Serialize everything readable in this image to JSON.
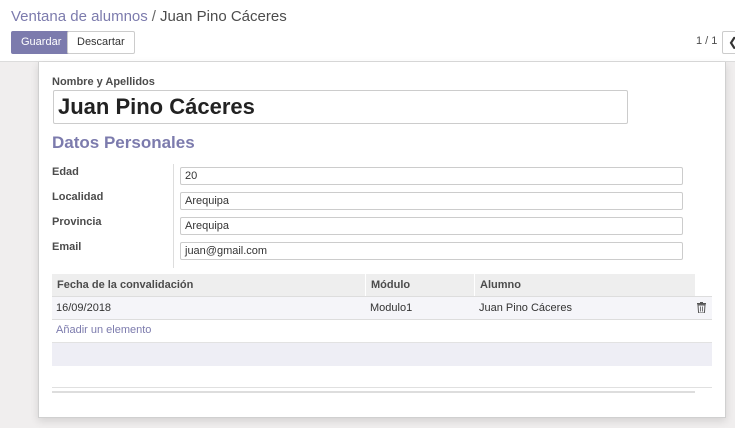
{
  "breadcrumb": {
    "parent": "Ventana de alumnos",
    "separator": "/",
    "current": "Juan Pino Cáceres"
  },
  "toolbar": {
    "save_label": "Guardar",
    "discard_label": "Descartar"
  },
  "pager": {
    "value": "1 / 1",
    "prev_icon": "chevron-left-icon"
  },
  "form": {
    "name_label": "Nombre y Apellidos",
    "name_value": "Juan Pino Cáceres",
    "group_title": "Datos Personales",
    "fields": {
      "edad": {
        "label": "Edad",
        "value": "20"
      },
      "localidad": {
        "label": "Localidad",
        "value": "Arequipa"
      },
      "provincia": {
        "label": "Provincia",
        "value": "Arequipa"
      },
      "email": {
        "label": "Email",
        "value": "juan@gmail.com"
      }
    }
  },
  "table": {
    "columns": [
      "Fecha de la convalidación",
      "Módulo",
      "Alumno"
    ],
    "rows": [
      {
        "fecha": "16/09/2018",
        "modulo": "Modulo1",
        "alumno": "Juan Pino Cáceres"
      }
    ],
    "add_line_label": "Añadir un elemento"
  },
  "colors": {
    "accent": "#7c7bad",
    "background": "#f0eeee",
    "sheet": "#ffffff"
  }
}
